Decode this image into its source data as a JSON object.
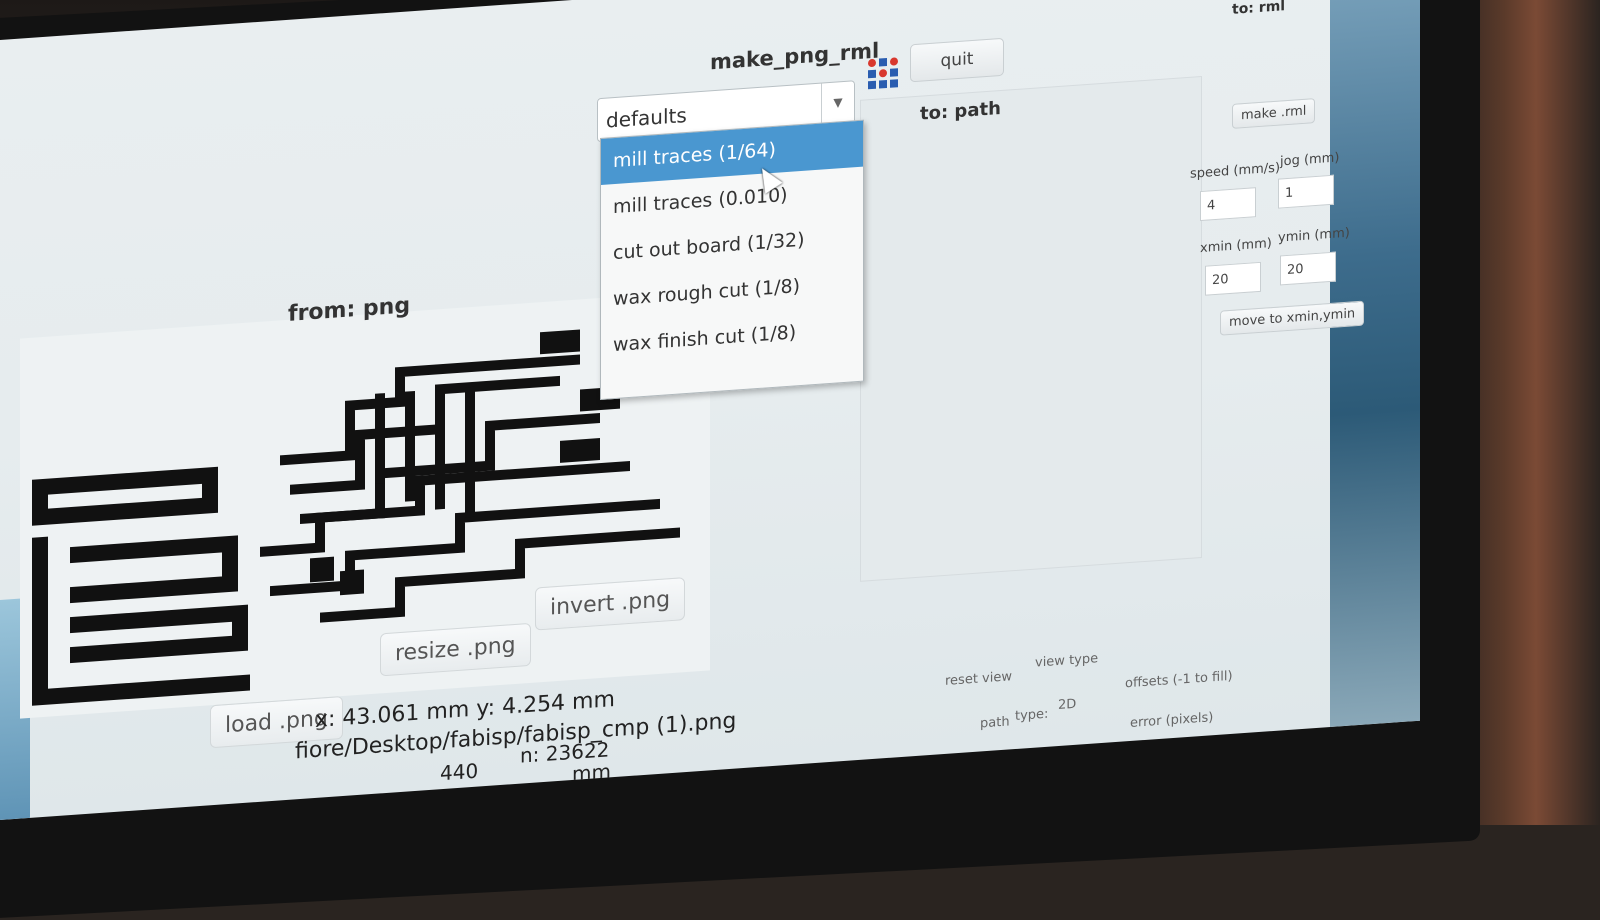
{
  "window": {
    "title": "make_png_rml",
    "quit_label": "quit"
  },
  "defaults_select": {
    "value": "defaults",
    "options": [
      "mill traces (1/64)",
      "mill traces (0.010)",
      "cut out board (1/32)",
      "wax rough cut (1/8)",
      "wax finish cut (1/8)"
    ]
  },
  "panels": {
    "from": "from: png",
    "to_path": "to: path",
    "to_rml": "to: rml"
  },
  "png_controls": {
    "load": "load .png",
    "resize": "resize .png",
    "invert": "invert .png",
    "coords": "x: 43.061 mm  y: 4.254 mm",
    "file_path": "fiore/Desktop/fabisp/fabisp_cmp (1).png",
    "dpi_fragment": "440",
    "px_fragment": "n: 23622",
    "mm_fragment": "mm"
  },
  "rml_controls": {
    "make_rml": "make .rml",
    "speed_label": "speed (mm/s)",
    "speed_value": "4",
    "jog_label": "jog (mm)",
    "jog_value": "1",
    "xmin_label": "xmin (mm)",
    "xmin_value": "20",
    "ymin_label": "ymin (mm)",
    "ymin_value": "20",
    "move_label": "move to xmin,ymin"
  },
  "path_controls": {
    "reset_view": "reset view",
    "view_type": "view type",
    "path_label": "path",
    "type_label": "type:",
    "type_value": "2D",
    "offsets_label": "offsets (-1 to fill)",
    "error_label": "error (pixels)"
  },
  "colors": {
    "selection": "#4a97d0",
    "icon_blue": "#2a5db0",
    "icon_red": "#d8382e"
  }
}
